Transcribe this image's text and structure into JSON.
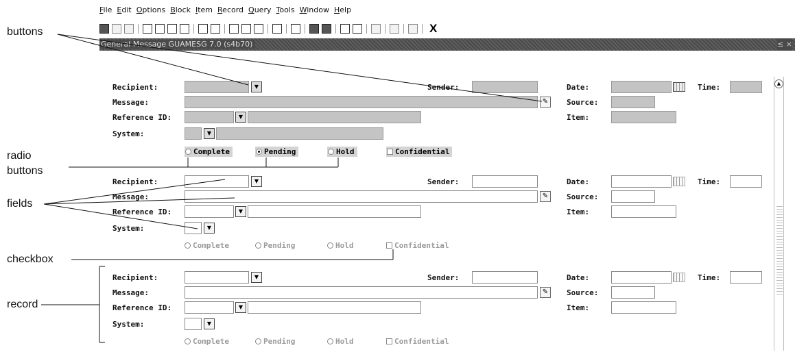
{
  "menu": [
    "File",
    "Edit",
    "Options",
    "Block",
    "Item",
    "Record",
    "Query",
    "Tools",
    "Window",
    "Help"
  ],
  "toolbar": {
    "close_label": "X"
  },
  "titlebar": {
    "title": "General Message  GUAMESG  7.0  (s4b70)",
    "controls": "≤ ×"
  },
  "labels": {
    "recipient": "Recipient:",
    "message": "Message:",
    "reference_id": "Reference ID:",
    "system": "System:",
    "sender": "Sender:",
    "date": "Date:",
    "time": "Time:",
    "source": "Source:",
    "item": "Item:"
  },
  "radios": {
    "complete": "Complete",
    "pending": "Pending",
    "hold": "Hold",
    "confidential": "Confidential"
  },
  "records": [
    {
      "state": "active",
      "selected_radio": "pending"
    },
    {
      "state": "inactive",
      "selected_radio": ""
    },
    {
      "state": "inactive",
      "selected_radio": ""
    }
  ],
  "annotations": {
    "buttons": "buttons",
    "radio_buttons_1": "radio",
    "radio_buttons_2": "buttons",
    "fields": "fields",
    "checkbox": "checkbox",
    "record": "record"
  }
}
